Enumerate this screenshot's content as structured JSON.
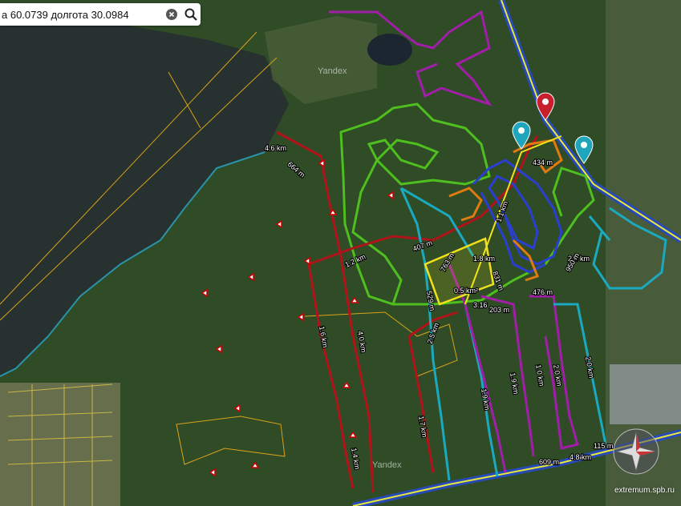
{
  "search": {
    "value": "а 60.0739 долгота 30.0984"
  },
  "map": {
    "provider_label": "Yandex",
    "attribution": "extremum.spb.ru",
    "colors": {
      "track_red": "#b0141a",
      "track_magenta": "#a01ea8",
      "track_green": "#4fbf1f",
      "track_cyan": "#1aa9bf",
      "track_blue": "#2a3fd0",
      "track_orange": "#e07a12",
      "zone_yellow": "#f2e21a",
      "marker_red": "#c8202a",
      "marker_cyan": "#1fa6bd"
    },
    "distance_labels": [
      "4.6 km",
      "664 m",
      "1.2 km",
      "1.6 km",
      "4.0 km",
      "1.4 km",
      "407 m",
      "1.8 km",
      "763 m",
      "0.5 km²",
      "831 m",
      "529 m",
      "2.5 km",
      "3.16",
      "203 m",
      "476 m",
      "1.1 km",
      "434 m",
      "2.4 km",
      "950 m",
      "1.9 km",
      "1.9 km",
      "1.0 km",
      "2.0 km",
      "2.0 km",
      "1.7 km",
      "115 m",
      "4.8 km",
      "609 m"
    ]
  }
}
